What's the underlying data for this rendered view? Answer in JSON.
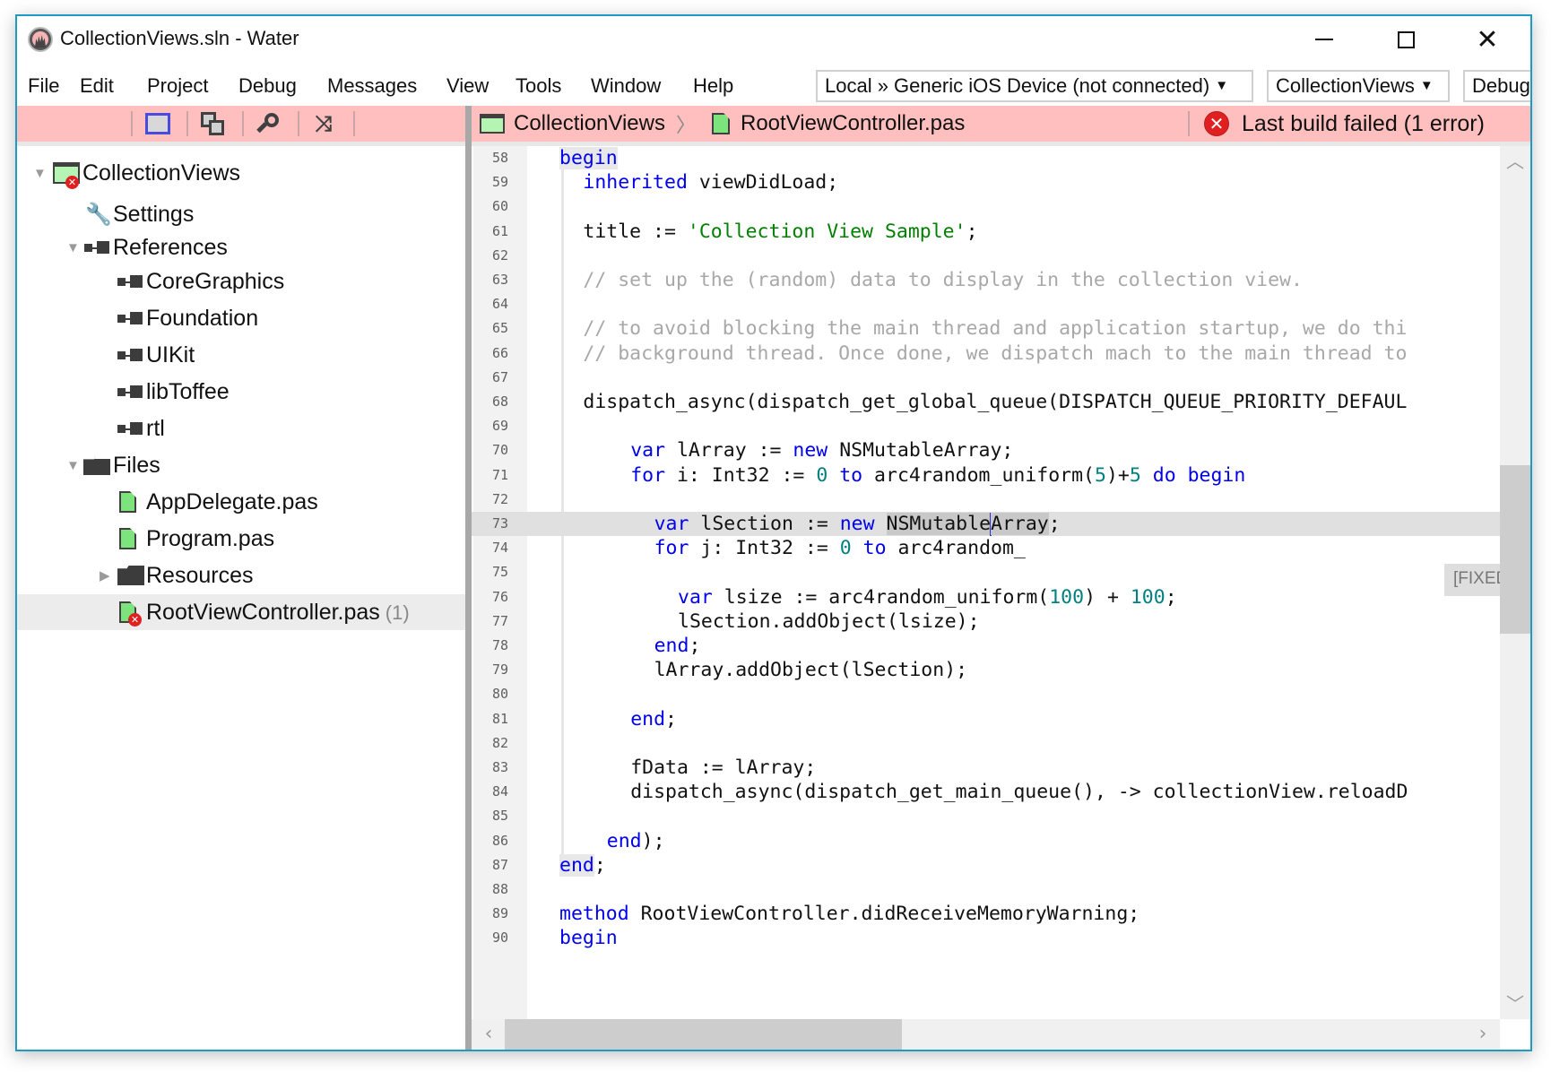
{
  "window": {
    "title": "CollectionViews.sln - Water",
    "controls": {
      "minimize": "minimize",
      "maximize": "maximize",
      "close": "✕"
    }
  },
  "menu": [
    "File",
    "Edit",
    "Project",
    "Debug",
    "Messages",
    "View",
    "Tools",
    "Window",
    "Help"
  ],
  "toolbar": {
    "device_combo": "Local » Generic iOS Device (not connected)",
    "project_combo": "CollectionViews",
    "config_combo": "Debug",
    "icons": [
      "solution-view-icon",
      "copy-windows-icon",
      "search-icon",
      "sync-icon"
    ]
  },
  "breadcrumb": {
    "project": "CollectionViews",
    "separator": "〉",
    "file": "RootViewController.pas"
  },
  "build_status": {
    "icon": "✕",
    "text": "Last build failed (1 error)",
    "color": "#e02020"
  },
  "sidebar": {
    "tree": [
      {
        "label": "CollectionViews",
        "icon": "project-icon",
        "expanded": true,
        "error": true
      },
      {
        "label": "Settings",
        "icon": "wrench-icon"
      },
      {
        "label": "References",
        "icon": "reference-icon",
        "expanded": true
      },
      {
        "label": "CoreGraphics",
        "icon": "reference-icon"
      },
      {
        "label": "Foundation",
        "icon": "reference-icon"
      },
      {
        "label": "UIKit",
        "icon": "reference-icon"
      },
      {
        "label": "libToffee",
        "icon": "reference-icon"
      },
      {
        "label": "rtl",
        "icon": "reference-icon"
      },
      {
        "label": "Files",
        "icon": "folder-open-icon",
        "expanded": true
      },
      {
        "label": "AppDelegate.pas",
        "icon": "file-icon"
      },
      {
        "label": "Program.pas",
        "icon": "file-icon"
      },
      {
        "label": "Resources",
        "icon": "folder-icon",
        "expanded": false
      },
      {
        "label": "RootViewController.pas",
        "icon": "file-icon",
        "error": true,
        "count": "(1)",
        "selected": true
      }
    ]
  },
  "editor": {
    "current_line": 73,
    "lines": [
      {
        "n": "58",
        "indent": 0,
        "tokens": [
          [
            "kw",
            "begin"
          ]
        ]
      },
      {
        "n": "59",
        "indent": 1,
        "tokens": [
          [
            "kw",
            "inherited"
          ],
          [
            "",
            " viewDidLoad;"
          ]
        ]
      },
      {
        "n": "60",
        "indent": 0,
        "tokens": []
      },
      {
        "n": "61",
        "indent": 1,
        "tokens": [
          [
            "",
            "title := "
          ],
          [
            "str",
            "'Collection View Sample'"
          ],
          [
            "",
            ";"
          ]
        ]
      },
      {
        "n": "62",
        "indent": 0,
        "tokens": []
      },
      {
        "n": "63",
        "indent": 1,
        "tokens": [
          [
            "cm",
            "// set up the (random) data to display in the collection view."
          ]
        ]
      },
      {
        "n": "64",
        "indent": 0,
        "tokens": []
      },
      {
        "n": "65",
        "indent": 1,
        "tokens": [
          [
            "cm",
            "// to avoid blocking the main thread and application startup, we do thi"
          ]
        ]
      },
      {
        "n": "66",
        "indent": 1,
        "tokens": [
          [
            "cm",
            "// background thread. Once done, we dispatch mach to the main thread to"
          ]
        ]
      },
      {
        "n": "67",
        "indent": 0,
        "tokens": []
      },
      {
        "n": "68",
        "indent": 1,
        "tokens": [
          [
            "",
            "dispatch_async(dispatch_get_global_queue(DISPATCH_QUEUE_PRIORITY_DEFAUL"
          ]
        ]
      },
      {
        "n": "69",
        "indent": 0,
        "tokens": []
      },
      {
        "n": "70",
        "indent": 3,
        "tokens": [
          [
            "kw",
            "var"
          ],
          [
            "",
            " lArray := "
          ],
          [
            "kw",
            "new"
          ],
          [
            "",
            " NSMutableArray;"
          ]
        ]
      },
      {
        "n": "71",
        "indent": 3,
        "tokens": [
          [
            "kw",
            "for"
          ],
          [
            "",
            " i: Int32 := "
          ],
          [
            "num",
            "0"
          ],
          [
            "",
            " "
          ],
          [
            "kw",
            "to"
          ],
          [
            "",
            " arc4random_uniform("
          ],
          [
            "num",
            "5"
          ],
          [
            "",
            ")+"
          ],
          [
            "num",
            "5"
          ],
          [
            "",
            " "
          ],
          [
            "kw",
            "do"
          ],
          [
            "",
            " "
          ],
          [
            "kw",
            "begin"
          ]
        ]
      },
      {
        "n": "72",
        "indent": 0,
        "tokens": []
      },
      {
        "n": "73",
        "indent": 4,
        "tokens": [
          [
            "kw",
            "var"
          ],
          [
            "",
            " lSection := "
          ],
          [
            "kw",
            "new"
          ],
          [
            "",
            " "
          ],
          [
            "sel",
            "NSMutable"
          ],
          [
            "caret",
            ""
          ],
          [
            "sel",
            "Array"
          ],
          [
            "",
            ";"
          ]
        ]
      },
      {
        "n": "74",
        "indent": 4,
        "tokens": [
          [
            "kw",
            "for"
          ],
          [
            "",
            " j: Int32 := "
          ],
          [
            "num",
            "0"
          ],
          [
            "",
            " "
          ],
          [
            "kw",
            "to"
          ],
          [
            "",
            " arc4random_"
          ]
        ]
      },
      {
        "n": "75",
        "indent": 0,
        "tokens": []
      },
      {
        "n": "76",
        "indent": 5,
        "tokens": [
          [
            "kw",
            "var"
          ],
          [
            "",
            " lsize := arc4random_uniform("
          ],
          [
            "num",
            "100"
          ],
          [
            "",
            ") + "
          ],
          [
            "num",
            "100"
          ],
          [
            "",
            ";"
          ]
        ]
      },
      {
        "n": "77",
        "indent": 5,
        "tokens": [
          [
            "",
            "lSection.addObject(lsize);"
          ]
        ]
      },
      {
        "n": "78",
        "indent": 4,
        "tokens": [
          [
            "kw",
            "end"
          ],
          [
            "",
            ";"
          ]
        ]
      },
      {
        "n": "79",
        "indent": 4,
        "tokens": [
          [
            "",
            "lArray.addObject(lSection);"
          ]
        ]
      },
      {
        "n": "80",
        "indent": 0,
        "tokens": []
      },
      {
        "n": "81",
        "indent": 3,
        "tokens": [
          [
            "kw",
            "end"
          ],
          [
            "",
            ";"
          ]
        ]
      },
      {
        "n": "82",
        "indent": 0,
        "tokens": []
      },
      {
        "n": "83",
        "indent": 3,
        "tokens": [
          [
            "",
            "fData := lArray;"
          ]
        ]
      },
      {
        "n": "84",
        "indent": 3,
        "tokens": [
          [
            "",
            "dispatch_async(dispatch_get_main_queue(), -> collectionView.reloadD"
          ]
        ]
      },
      {
        "n": "85",
        "indent": 0,
        "tokens": []
      },
      {
        "n": "86",
        "indent": 2,
        "tokens": [
          [
            "kw",
            "end"
          ],
          [
            "",
            ");"
          ]
        ]
      },
      {
        "n": "87",
        "indent": 0,
        "tokens": [
          [
            "kwhl",
            "end"
          ],
          [
            "",
            ";"
          ]
        ]
      },
      {
        "n": "88",
        "indent": 0,
        "tokens": []
      },
      {
        "n": "89",
        "indent": 0,
        "tokens": [
          [
            "kw",
            "method"
          ],
          [
            "",
            " RootViewController.didReceiveMemoryWarning;"
          ]
        ]
      },
      {
        "n": "90",
        "indent": 0,
        "tokens": [
          [
            "kw",
            "begin"
          ]
        ]
      }
    ],
    "tooltip": "[FIXED] Case does not match \"NSMutableArray\"",
    "vertical_scroll_position": 0.35,
    "horizontal_scroll_position": 0.0
  }
}
